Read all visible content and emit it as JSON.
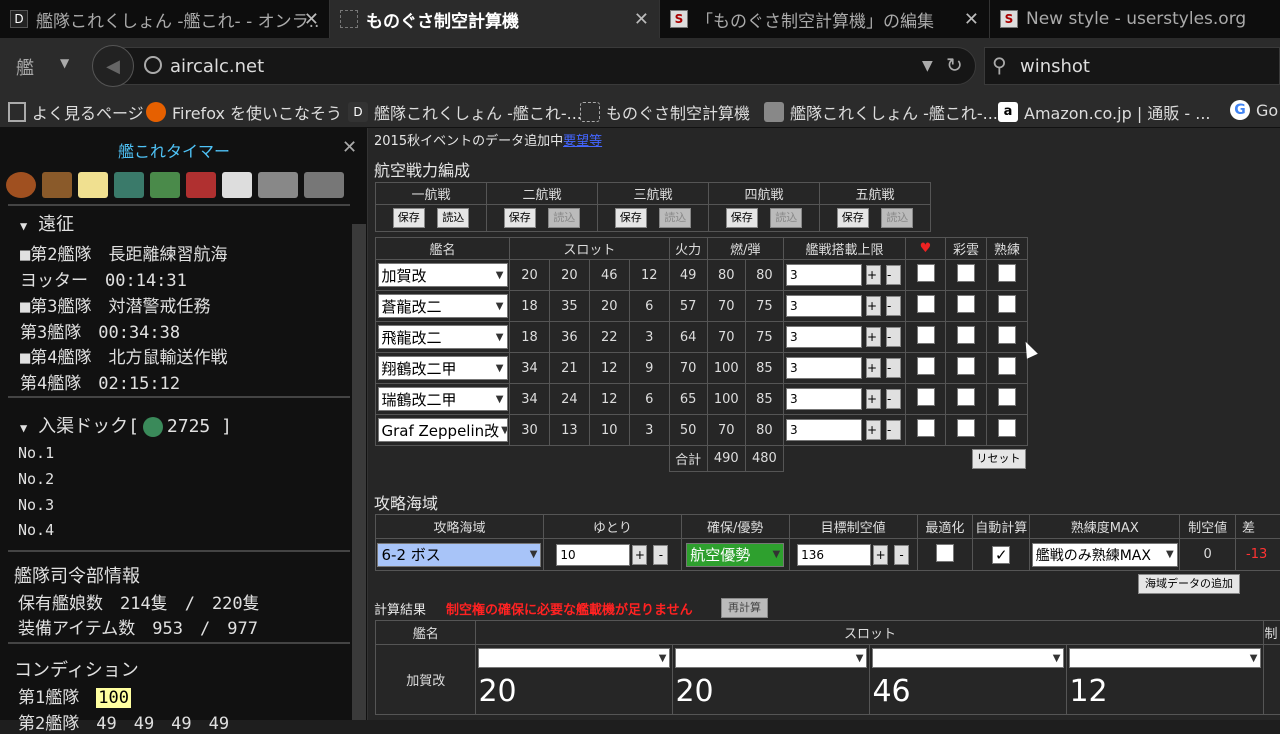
{
  "browser": {
    "tabs": [
      {
        "title": "艦隊これくしょん -艦これ- - オンラ...",
        "icon": "D"
      },
      {
        "title": "ものぐさ制空計算機",
        "icon": ""
      },
      {
        "title": "「ものぐさ制空計算機」の編集",
        "icon": "S"
      },
      {
        "title": "New style - userstyles.org",
        "icon": "S"
      }
    ],
    "url": "aircalc.net",
    "search": "winshot",
    "bookmarks": [
      "よく見るページ",
      "Firefox を使いこなそう",
      "艦隊これくしょん -艦これ-...",
      "ものぐさ制空計算機",
      "艦隊これくしょん -艦これ-...",
      "Amazon.co.jp | 通販 - ...",
      "Go"
    ]
  },
  "sidebar": {
    "title": "艦これタイマー",
    "expedition_header": "遠征",
    "expeditions": [
      {
        "fleet": "■第2艦隊　長距離練習航海",
        "status": "ヨッター　00:14:31"
      },
      {
        "fleet": "■第3艦隊　対潜警戒任務",
        "status": "第3艦隊　00:34:38"
      },
      {
        "fleet": "■第4艦隊　北方鼠輸送作戦",
        "status": "第4艦隊　02:15:12"
      }
    ],
    "dock_header": "入渠ドック[",
    "dock_count": "2725 ]",
    "docks": [
      "No.1",
      "No.2",
      "No.3",
      "No.4"
    ],
    "hq_header": "艦隊司令部情報",
    "ships_line": "保有艦娘数　214隻　/　220隻",
    "items_line": "装備アイテム数　953　/　977",
    "condition_header": "コンディション",
    "fleet1_label": "第1艦隊",
    "fleet1_value": "100",
    "fleet2_partial": "第2艦隊　49　49　49　49"
  },
  "main": {
    "notice": "2015秋イベントのデータ追加中",
    "notice_link": "要望等",
    "section1_title": "航空戦力編成",
    "fleet_tabs": [
      "一航戦",
      "二航戦",
      "三航戦",
      "四航戦",
      "五航戦"
    ],
    "save_label": "保存",
    "load_label": "読込",
    "headers": {
      "name": "艦名",
      "slot": "スロット",
      "firepower": "火力",
      "fuel_ammo": "燃/弾",
      "limit": "艦戦搭載上限",
      "heart": "♥",
      "saiun": "彩雲",
      "skill": "熟練"
    },
    "ships": [
      {
        "name": "加賀改",
        "slots": [
          "20",
          "20",
          "46",
          "12"
        ],
        "fp": "49",
        "fuel": "80",
        "ammo": "80",
        "limit": "3"
      },
      {
        "name": "蒼龍改二",
        "slots": [
          "18",
          "35",
          "20",
          "6"
        ],
        "fp": "57",
        "fuel": "70",
        "ammo": "75",
        "limit": "3"
      },
      {
        "name": "飛龍改二",
        "slots": [
          "18",
          "36",
          "22",
          "3"
        ],
        "fp": "64",
        "fuel": "70",
        "ammo": "75",
        "limit": "3"
      },
      {
        "name": "翔鶴改二甲",
        "slots": [
          "34",
          "21",
          "12",
          "9"
        ],
        "fp": "70",
        "fuel": "100",
        "ammo": "85",
        "limit": "3"
      },
      {
        "name": "瑞鶴改二甲",
        "slots": [
          "34",
          "24",
          "12",
          "6"
        ],
        "fp": "65",
        "fuel": "100",
        "ammo": "85",
        "limit": "3"
      },
      {
        "name": "Graf Zeppelin改",
        "slots": [
          "30",
          "13",
          "10",
          "3"
        ],
        "fp": "50",
        "fuel": "70",
        "ammo": "80",
        "limit": "3"
      }
    ],
    "total_label": "合計",
    "total_fuel": "490",
    "total_ammo": "480",
    "reset_label": "リセット",
    "plus": "+",
    "minus": "-",
    "section2_title": "攻略海域",
    "area_headers": [
      "攻略海域",
      "ゆとり",
      "確保/優勢",
      "目標制空値",
      "最適化",
      "自動計算",
      "熟練度MAX",
      "制空値",
      "差"
    ],
    "area_value": "6-2 ボス",
    "margin_value": "10",
    "air_state": "航空優勢",
    "target_air": "136",
    "auto_calc_check": "✓",
    "skill_max": "艦戦のみ熟練MAX",
    "air_value": "0",
    "diff_value": "-13",
    "add_area_label": "海域データの追加",
    "result_title": "計算結果",
    "result_warning": "制空権の確保に必要な艦載機が足りません",
    "recalc_label": "再計算",
    "result_headers": {
      "name": "艦名",
      "slot": "スロット",
      "extra": "制"
    },
    "result_ship": "加賀改",
    "result_slots": [
      "20",
      "20",
      "46",
      "12"
    ]
  },
  "colors": {
    "sidebar_title": "#4fc3f7",
    "fuel_green": "#2e9b2e",
    "ammo_orange": "#d6a200",
    "warning_red": "#ff2222",
    "area_select": "#a8c4f8",
    "air_state_green": "#2ea02e"
  }
}
